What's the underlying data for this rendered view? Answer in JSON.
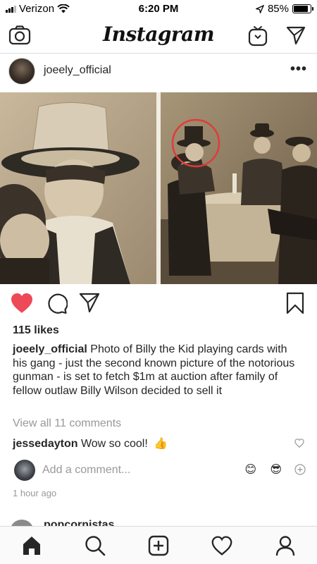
{
  "status_bar": {
    "carrier": "Verizon",
    "time": "6:20 PM",
    "battery": "85%",
    "battery_level": 0.85,
    "signal_bars": 3
  },
  "nav": {
    "logo": "Instagram",
    "icons": [
      "camera-icon",
      "igtv-icon",
      "direct-message-icon"
    ]
  },
  "post": {
    "username": "joeely_official",
    "more_label": "•••",
    "likes": "115 likes",
    "caption_user": "joeely_official",
    "caption_text": "Photo of Billy the Kid playing cards with his gang - just the second known picture of the notorious gunman - is set to fetch $1m at auction after family of fellow outlaw Billy Wilson decided to sell it",
    "view_comments": "View all 11 comments",
    "comment": {
      "user": "jesseday ton",
      "user_display": "jessedayton",
      "text": "Wow so cool!",
      "emoji": "👍"
    },
    "add_comment_placeholder": "Add a comment...",
    "quick_emojis": [
      "😊",
      "😎"
    ],
    "time_ago": "1 hour ago",
    "liked": true,
    "like_color": "#ed4956"
  },
  "next_post": {
    "username": "popcornistas"
  },
  "tabbar": {
    "tabs": [
      "home-icon",
      "search-icon",
      "new-post-icon",
      "activity-icon",
      "profile-icon"
    ]
  }
}
